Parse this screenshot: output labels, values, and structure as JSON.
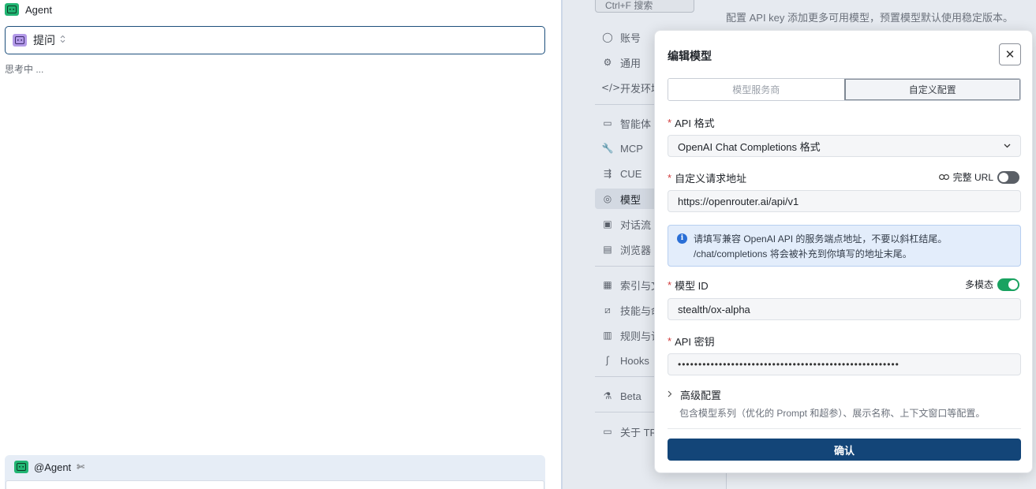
{
  "chat": {
    "agent_title": "Agent",
    "mode_label": "提问",
    "mode_caret": "⌃⌄",
    "status": "思考中 ...",
    "composer_label": "@Agent",
    "composer_tool_icon": "✄"
  },
  "settings": {
    "search_placeholder": "Ctrl+F 搜索",
    "description": "配置 API key 添加更多可用模型，预置模型默认使用稳定版本。",
    "nav": [
      {
        "label": "账号",
        "icon": "account-icon"
      },
      {
        "label": "通用",
        "icon": "gear-icon"
      },
      {
        "label": "开发环境",
        "icon": "code-icon"
      },
      {
        "label": "智能体",
        "icon": "bot-icon"
      },
      {
        "label": "MCP",
        "icon": "wrench-icon"
      },
      {
        "label": "CUE",
        "icon": "cue-icon"
      },
      {
        "label": "模型",
        "icon": "model-icon"
      },
      {
        "label": "对话流",
        "icon": "chat-flow-icon"
      },
      {
        "label": "浏览器",
        "icon": "browser-icon"
      },
      {
        "label": "索引与文",
        "icon": "index-icon"
      },
      {
        "label": "技能与命",
        "icon": "skill-icon"
      },
      {
        "label": "规则与记",
        "icon": "rules-icon"
      },
      {
        "label": "Hooks",
        "icon": "hook-icon"
      },
      {
        "label": "Beta",
        "icon": "beta-icon"
      },
      {
        "label": "关于 TR",
        "icon": "about-icon"
      }
    ],
    "nav_glyphs": [
      "◯",
      "⚙",
      "</>",
      "▭",
      "🔧",
      "⇶",
      "◎",
      "▣",
      "▤",
      "▦",
      "⧄",
      "▥",
      "ʃ",
      "⚗",
      "▭"
    ]
  },
  "modal": {
    "title": "编辑模型",
    "close": "✕",
    "tabs": [
      "模型服务商",
      "自定义配置"
    ],
    "active_tab": 1,
    "api_format_label": "API 格式",
    "api_format_value": "OpenAI Chat Completions 格式",
    "url_label": "自定义请求地址",
    "full_url_label": "完整 URL",
    "full_url_enabled": false,
    "url_value": "https://openrouter.ai/api/v1",
    "info_line1": "请填写兼容 OpenAI API 的服务端点地址，不要以斜杠结尾。",
    "info_line2": "/chat/completions 将会被补充到你填写的地址末尾。",
    "model_id_label": "模型 ID",
    "multimodal_label": "多模态",
    "multimodal_enabled": true,
    "model_id_value": "stealth/ox-alpha",
    "api_key_label": "API 密钥",
    "api_key_masked": "••••••••••••••••••••••••••••••••••••••••••••••••••••••",
    "advanced_label": "高级配置",
    "advanced_desc": "包含模型系列（优化的 Prompt 和超参）、展示名称、上下文窗口等配置。",
    "confirm_label": "确认"
  },
  "colors": {
    "accent": "#134578",
    "toggle_on": "#19a260",
    "info_bg": "#e3edfb",
    "required": "#d13b3b"
  }
}
